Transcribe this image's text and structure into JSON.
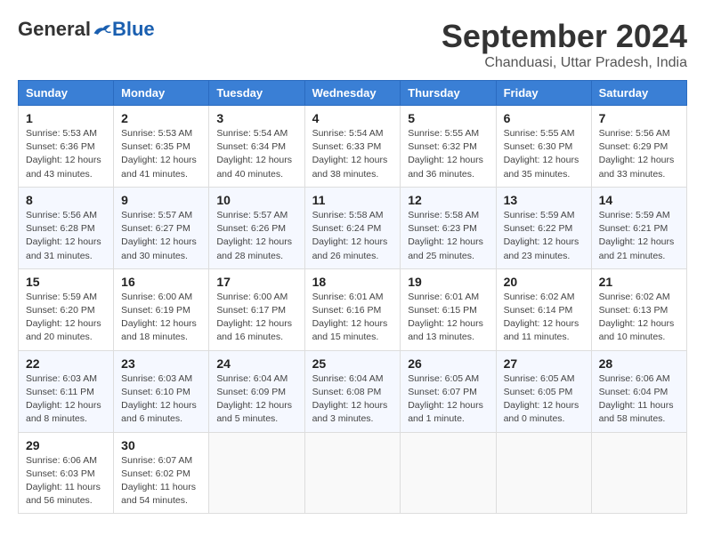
{
  "logo": {
    "general": "General",
    "blue": "Blue"
  },
  "header": {
    "month": "September 2024",
    "location": "Chanduasi, Uttar Pradesh, India"
  },
  "weekdays": [
    "Sunday",
    "Monday",
    "Tuesday",
    "Wednesday",
    "Thursday",
    "Friday",
    "Saturday"
  ],
  "weeks": [
    [
      {
        "day": "1",
        "info": "Sunrise: 5:53 AM\nSunset: 6:36 PM\nDaylight: 12 hours\nand 43 minutes."
      },
      {
        "day": "2",
        "info": "Sunrise: 5:53 AM\nSunset: 6:35 PM\nDaylight: 12 hours\nand 41 minutes."
      },
      {
        "day": "3",
        "info": "Sunrise: 5:54 AM\nSunset: 6:34 PM\nDaylight: 12 hours\nand 40 minutes."
      },
      {
        "day": "4",
        "info": "Sunrise: 5:54 AM\nSunset: 6:33 PM\nDaylight: 12 hours\nand 38 minutes."
      },
      {
        "day": "5",
        "info": "Sunrise: 5:55 AM\nSunset: 6:32 PM\nDaylight: 12 hours\nand 36 minutes."
      },
      {
        "day": "6",
        "info": "Sunrise: 5:55 AM\nSunset: 6:30 PM\nDaylight: 12 hours\nand 35 minutes."
      },
      {
        "day": "7",
        "info": "Sunrise: 5:56 AM\nSunset: 6:29 PM\nDaylight: 12 hours\nand 33 minutes."
      }
    ],
    [
      {
        "day": "8",
        "info": "Sunrise: 5:56 AM\nSunset: 6:28 PM\nDaylight: 12 hours\nand 31 minutes."
      },
      {
        "day": "9",
        "info": "Sunrise: 5:57 AM\nSunset: 6:27 PM\nDaylight: 12 hours\nand 30 minutes."
      },
      {
        "day": "10",
        "info": "Sunrise: 5:57 AM\nSunset: 6:26 PM\nDaylight: 12 hours\nand 28 minutes."
      },
      {
        "day": "11",
        "info": "Sunrise: 5:58 AM\nSunset: 6:24 PM\nDaylight: 12 hours\nand 26 minutes."
      },
      {
        "day": "12",
        "info": "Sunrise: 5:58 AM\nSunset: 6:23 PM\nDaylight: 12 hours\nand 25 minutes."
      },
      {
        "day": "13",
        "info": "Sunrise: 5:59 AM\nSunset: 6:22 PM\nDaylight: 12 hours\nand 23 minutes."
      },
      {
        "day": "14",
        "info": "Sunrise: 5:59 AM\nSunset: 6:21 PM\nDaylight: 12 hours\nand 21 minutes."
      }
    ],
    [
      {
        "day": "15",
        "info": "Sunrise: 5:59 AM\nSunset: 6:20 PM\nDaylight: 12 hours\nand 20 minutes."
      },
      {
        "day": "16",
        "info": "Sunrise: 6:00 AM\nSunset: 6:19 PM\nDaylight: 12 hours\nand 18 minutes."
      },
      {
        "day": "17",
        "info": "Sunrise: 6:00 AM\nSunset: 6:17 PM\nDaylight: 12 hours\nand 16 minutes."
      },
      {
        "day": "18",
        "info": "Sunrise: 6:01 AM\nSunset: 6:16 PM\nDaylight: 12 hours\nand 15 minutes."
      },
      {
        "day": "19",
        "info": "Sunrise: 6:01 AM\nSunset: 6:15 PM\nDaylight: 12 hours\nand 13 minutes."
      },
      {
        "day": "20",
        "info": "Sunrise: 6:02 AM\nSunset: 6:14 PM\nDaylight: 12 hours\nand 11 minutes."
      },
      {
        "day": "21",
        "info": "Sunrise: 6:02 AM\nSunset: 6:13 PM\nDaylight: 12 hours\nand 10 minutes."
      }
    ],
    [
      {
        "day": "22",
        "info": "Sunrise: 6:03 AM\nSunset: 6:11 PM\nDaylight: 12 hours\nand 8 minutes."
      },
      {
        "day": "23",
        "info": "Sunrise: 6:03 AM\nSunset: 6:10 PM\nDaylight: 12 hours\nand 6 minutes."
      },
      {
        "day": "24",
        "info": "Sunrise: 6:04 AM\nSunset: 6:09 PM\nDaylight: 12 hours\nand 5 minutes."
      },
      {
        "day": "25",
        "info": "Sunrise: 6:04 AM\nSunset: 6:08 PM\nDaylight: 12 hours\nand 3 minutes."
      },
      {
        "day": "26",
        "info": "Sunrise: 6:05 AM\nSunset: 6:07 PM\nDaylight: 12 hours\nand 1 minute."
      },
      {
        "day": "27",
        "info": "Sunrise: 6:05 AM\nSunset: 6:05 PM\nDaylight: 12 hours\nand 0 minutes."
      },
      {
        "day": "28",
        "info": "Sunrise: 6:06 AM\nSunset: 6:04 PM\nDaylight: 11 hours\nand 58 minutes."
      }
    ],
    [
      {
        "day": "29",
        "info": "Sunrise: 6:06 AM\nSunset: 6:03 PM\nDaylight: 11 hours\nand 56 minutes."
      },
      {
        "day": "30",
        "info": "Sunrise: 6:07 AM\nSunset: 6:02 PM\nDaylight: 11 hours\nand 54 minutes."
      },
      null,
      null,
      null,
      null,
      null
    ]
  ]
}
